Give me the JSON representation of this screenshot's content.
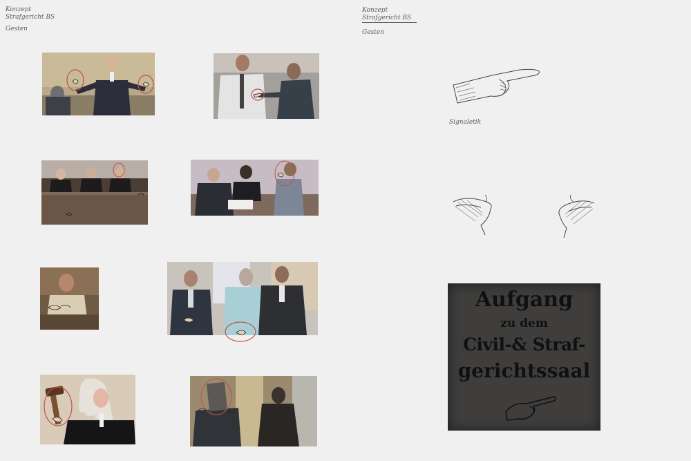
{
  "notes": {
    "left": {
      "line1": "Konzept",
      "line2": "Strafgericht BS",
      "line3": "Gesten"
    },
    "right": {
      "line1": "Konzept",
      "line2": "Strafgericht BS",
      "line3": "Gesten"
    },
    "sketch_caption": "Signaletik"
  },
  "sign": {
    "line1": "Aufgang",
    "line2": "zu dem",
    "line3": "Civil-& Straf-",
    "line4": "gerichtssaal"
  },
  "colors": {
    "page": "#f1f0f0",
    "pencil": "#5d5d5d",
    "highlight_circle": "#c0504d",
    "sign": "#3f3e3d"
  }
}
